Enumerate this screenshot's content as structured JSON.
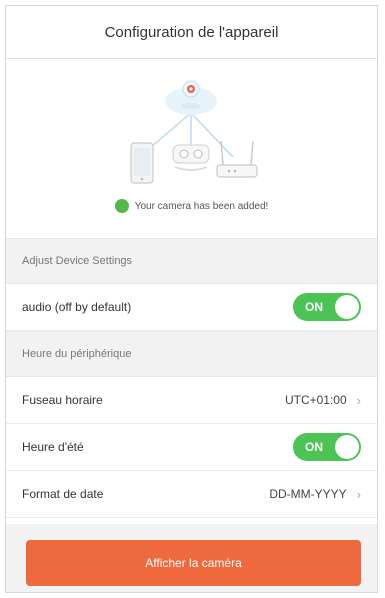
{
  "header": {
    "title": "Configuration de l'appareil"
  },
  "hero": {
    "added_text": "Your camera has been added!"
  },
  "sections": {
    "device_settings": "Adjust Device Settings",
    "device_time": "Heure du périphérique"
  },
  "audio": {
    "label": "audio (off by default)",
    "toggle": "ON"
  },
  "timezone": {
    "label": "Fuseau horaire",
    "value": "UTC+01:00"
  },
  "dst": {
    "label": "Heure d'été",
    "toggle": "ON"
  },
  "date_format": {
    "label": "Format de date",
    "value": "DD-MM-YYYY"
  },
  "cta": {
    "label": "Afficher la caméra"
  },
  "colors": {
    "accent": "#ee6a3e",
    "toggle_on": "#4cc455",
    "check": "#52b84b"
  },
  "icons": [
    "camera-icon",
    "phone-icon",
    "router-icon",
    "check-icon",
    "chevron-right-icon"
  ]
}
